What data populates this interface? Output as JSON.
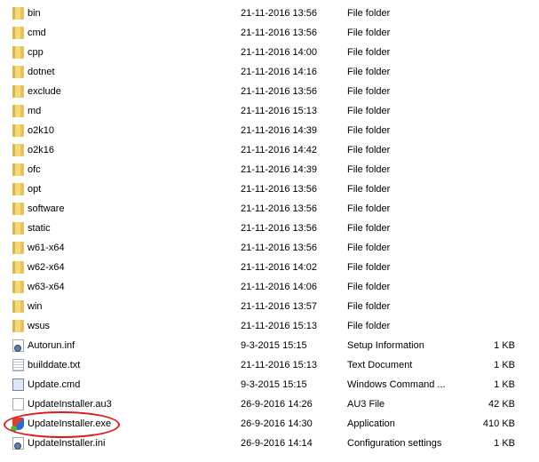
{
  "files": [
    {
      "name": "bin",
      "date": "21-11-2016 13:56",
      "type": "File folder",
      "size": "",
      "icon": "folder-icon"
    },
    {
      "name": "cmd",
      "date": "21-11-2016 13:56",
      "type": "File folder",
      "size": "",
      "icon": "folder-icon"
    },
    {
      "name": "cpp",
      "date": "21-11-2016 14:00",
      "type": "File folder",
      "size": "",
      "icon": "folder-icon"
    },
    {
      "name": "dotnet",
      "date": "21-11-2016 14:16",
      "type": "File folder",
      "size": "",
      "icon": "folder-icon"
    },
    {
      "name": "exclude",
      "date": "21-11-2016 13:56",
      "type": "File folder",
      "size": "",
      "icon": "folder-icon"
    },
    {
      "name": "md",
      "date": "21-11-2016 15:13",
      "type": "File folder",
      "size": "",
      "icon": "folder-icon"
    },
    {
      "name": "o2k10",
      "date": "21-11-2016 14:39",
      "type": "File folder",
      "size": "",
      "icon": "folder-icon"
    },
    {
      "name": "o2k16",
      "date": "21-11-2016 14:42",
      "type": "File folder",
      "size": "",
      "icon": "folder-icon"
    },
    {
      "name": "ofc",
      "date": "21-11-2016 14:39",
      "type": "File folder",
      "size": "",
      "icon": "folder-icon"
    },
    {
      "name": "opt",
      "date": "21-11-2016 13:56",
      "type": "File folder",
      "size": "",
      "icon": "folder-icon"
    },
    {
      "name": "software",
      "date": "21-11-2016 13:56",
      "type": "File folder",
      "size": "",
      "icon": "folder-icon"
    },
    {
      "name": "static",
      "date": "21-11-2016 13:56",
      "type": "File folder",
      "size": "",
      "icon": "folder-icon"
    },
    {
      "name": "w61-x64",
      "date": "21-11-2016 13:56",
      "type": "File folder",
      "size": "",
      "icon": "folder-icon"
    },
    {
      "name": "w62-x64",
      "date": "21-11-2016 14:02",
      "type": "File folder",
      "size": "",
      "icon": "folder-icon"
    },
    {
      "name": "w63-x64",
      "date": "21-11-2016 14:06",
      "type": "File folder",
      "size": "",
      "icon": "folder-icon"
    },
    {
      "name": "win",
      "date": "21-11-2016 13:57",
      "type": "File folder",
      "size": "",
      "icon": "folder-icon"
    },
    {
      "name": "wsus",
      "date": "21-11-2016 15:13",
      "type": "File folder",
      "size": "",
      "icon": "folder-icon"
    },
    {
      "name": "Autorun.inf",
      "date": "9-3-2015 15:15",
      "type": "Setup Information",
      "size": "1 KB",
      "icon": "settings-file-icon"
    },
    {
      "name": "builddate.txt",
      "date": "21-11-2016 15:13",
      "type": "Text Document",
      "size": "1 KB",
      "icon": "text-file-icon"
    },
    {
      "name": "Update.cmd",
      "date": "9-3-2015 15:15",
      "type": "Windows Command ...",
      "size": "1 KB",
      "icon": "command-file-icon"
    },
    {
      "name": "UpdateInstaller.au3",
      "date": "26-9-2016 14:26",
      "type": "AU3 File",
      "size": "42 KB",
      "icon": "blank-file-icon"
    },
    {
      "name": "UpdateInstaller.exe",
      "date": "26-9-2016 14:30",
      "type": "Application",
      "size": "410 KB",
      "icon": "application-icon"
    },
    {
      "name": "UpdateInstaller.ini",
      "date": "26-9-2016 14:14",
      "type": "Configuration settings",
      "size": "1 KB",
      "icon": "settings-file-icon"
    }
  ],
  "highlight_color": "#e0191b"
}
